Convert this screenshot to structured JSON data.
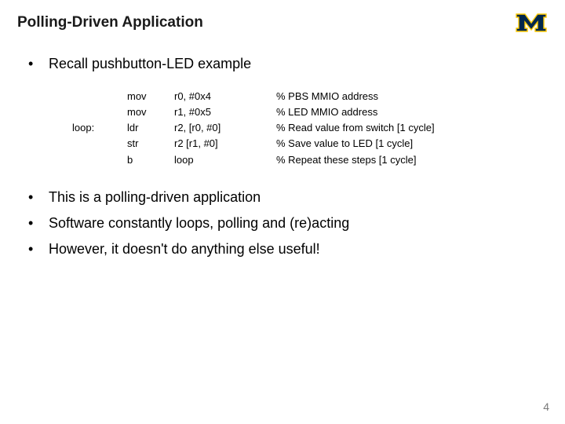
{
  "title": "Polling-Driven Application",
  "logo": {
    "alt": "University of Michigan block M"
  },
  "bullets_top": [
    "Recall pushbutton-LED example"
  ],
  "code": {
    "rows": [
      {
        "label": "",
        "op": "mov",
        "args": "r0, #0x4",
        "comment": "% PBS MMIO address"
      },
      {
        "label": "",
        "op": "mov",
        "args": "r1, #0x5",
        "comment": "% LED MMIO address"
      },
      {
        "label": "loop:",
        "op": "ldr",
        "args": "r2, [r0, #0]",
        "comment": "% Read value from switch [1 cycle]"
      },
      {
        "label": "",
        "op": "str",
        "args": "r2 [r1, #0]",
        "comment": "% Save value to LED [1 cycle]"
      },
      {
        "label": "",
        "op": "b",
        "args": "loop",
        "comment": "% Repeat these steps [1 cycle]"
      }
    ]
  },
  "bullets_bottom": [
    "This is a polling-driven application",
    "Software constantly loops, polling and (re)acting",
    "However, it doesn't do anything else useful!"
  ],
  "page_number": "4"
}
